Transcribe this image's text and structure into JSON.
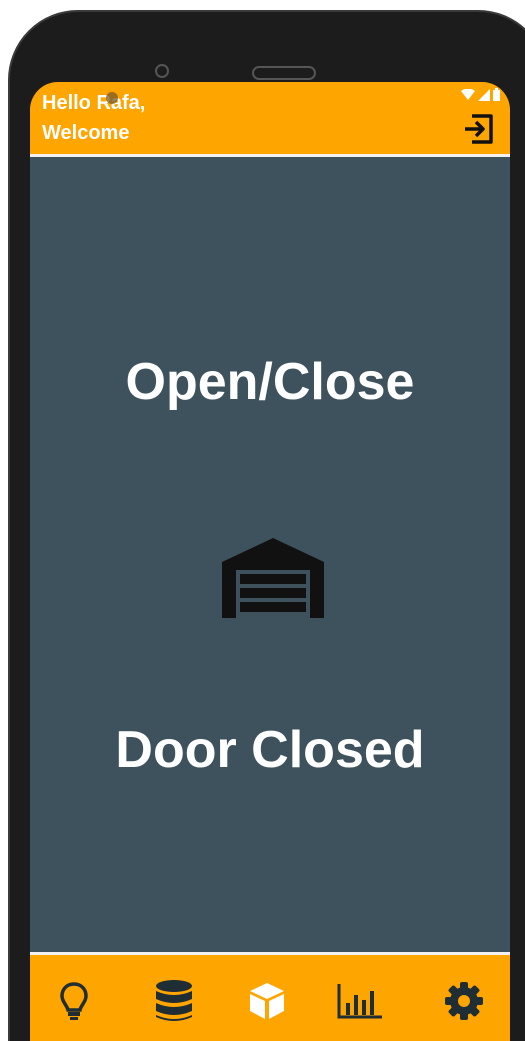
{
  "header": {
    "greeting_line1": "Hello Rafa,",
    "greeting_line2": "Welcome"
  },
  "main": {
    "title": "Open/Close",
    "door_status": "Door Closed"
  },
  "icons": {
    "logout": "logout-icon",
    "garage": "garage-door-icon",
    "nav": [
      "lightbulb-icon",
      "database-icon",
      "cube-icon",
      "bar-chart-icon",
      "gear-icon"
    ]
  },
  "colors": {
    "accent": "#ffa500",
    "background": "#3d525d",
    "text": "#ffffff",
    "icon_dark": "#1f2d34"
  }
}
